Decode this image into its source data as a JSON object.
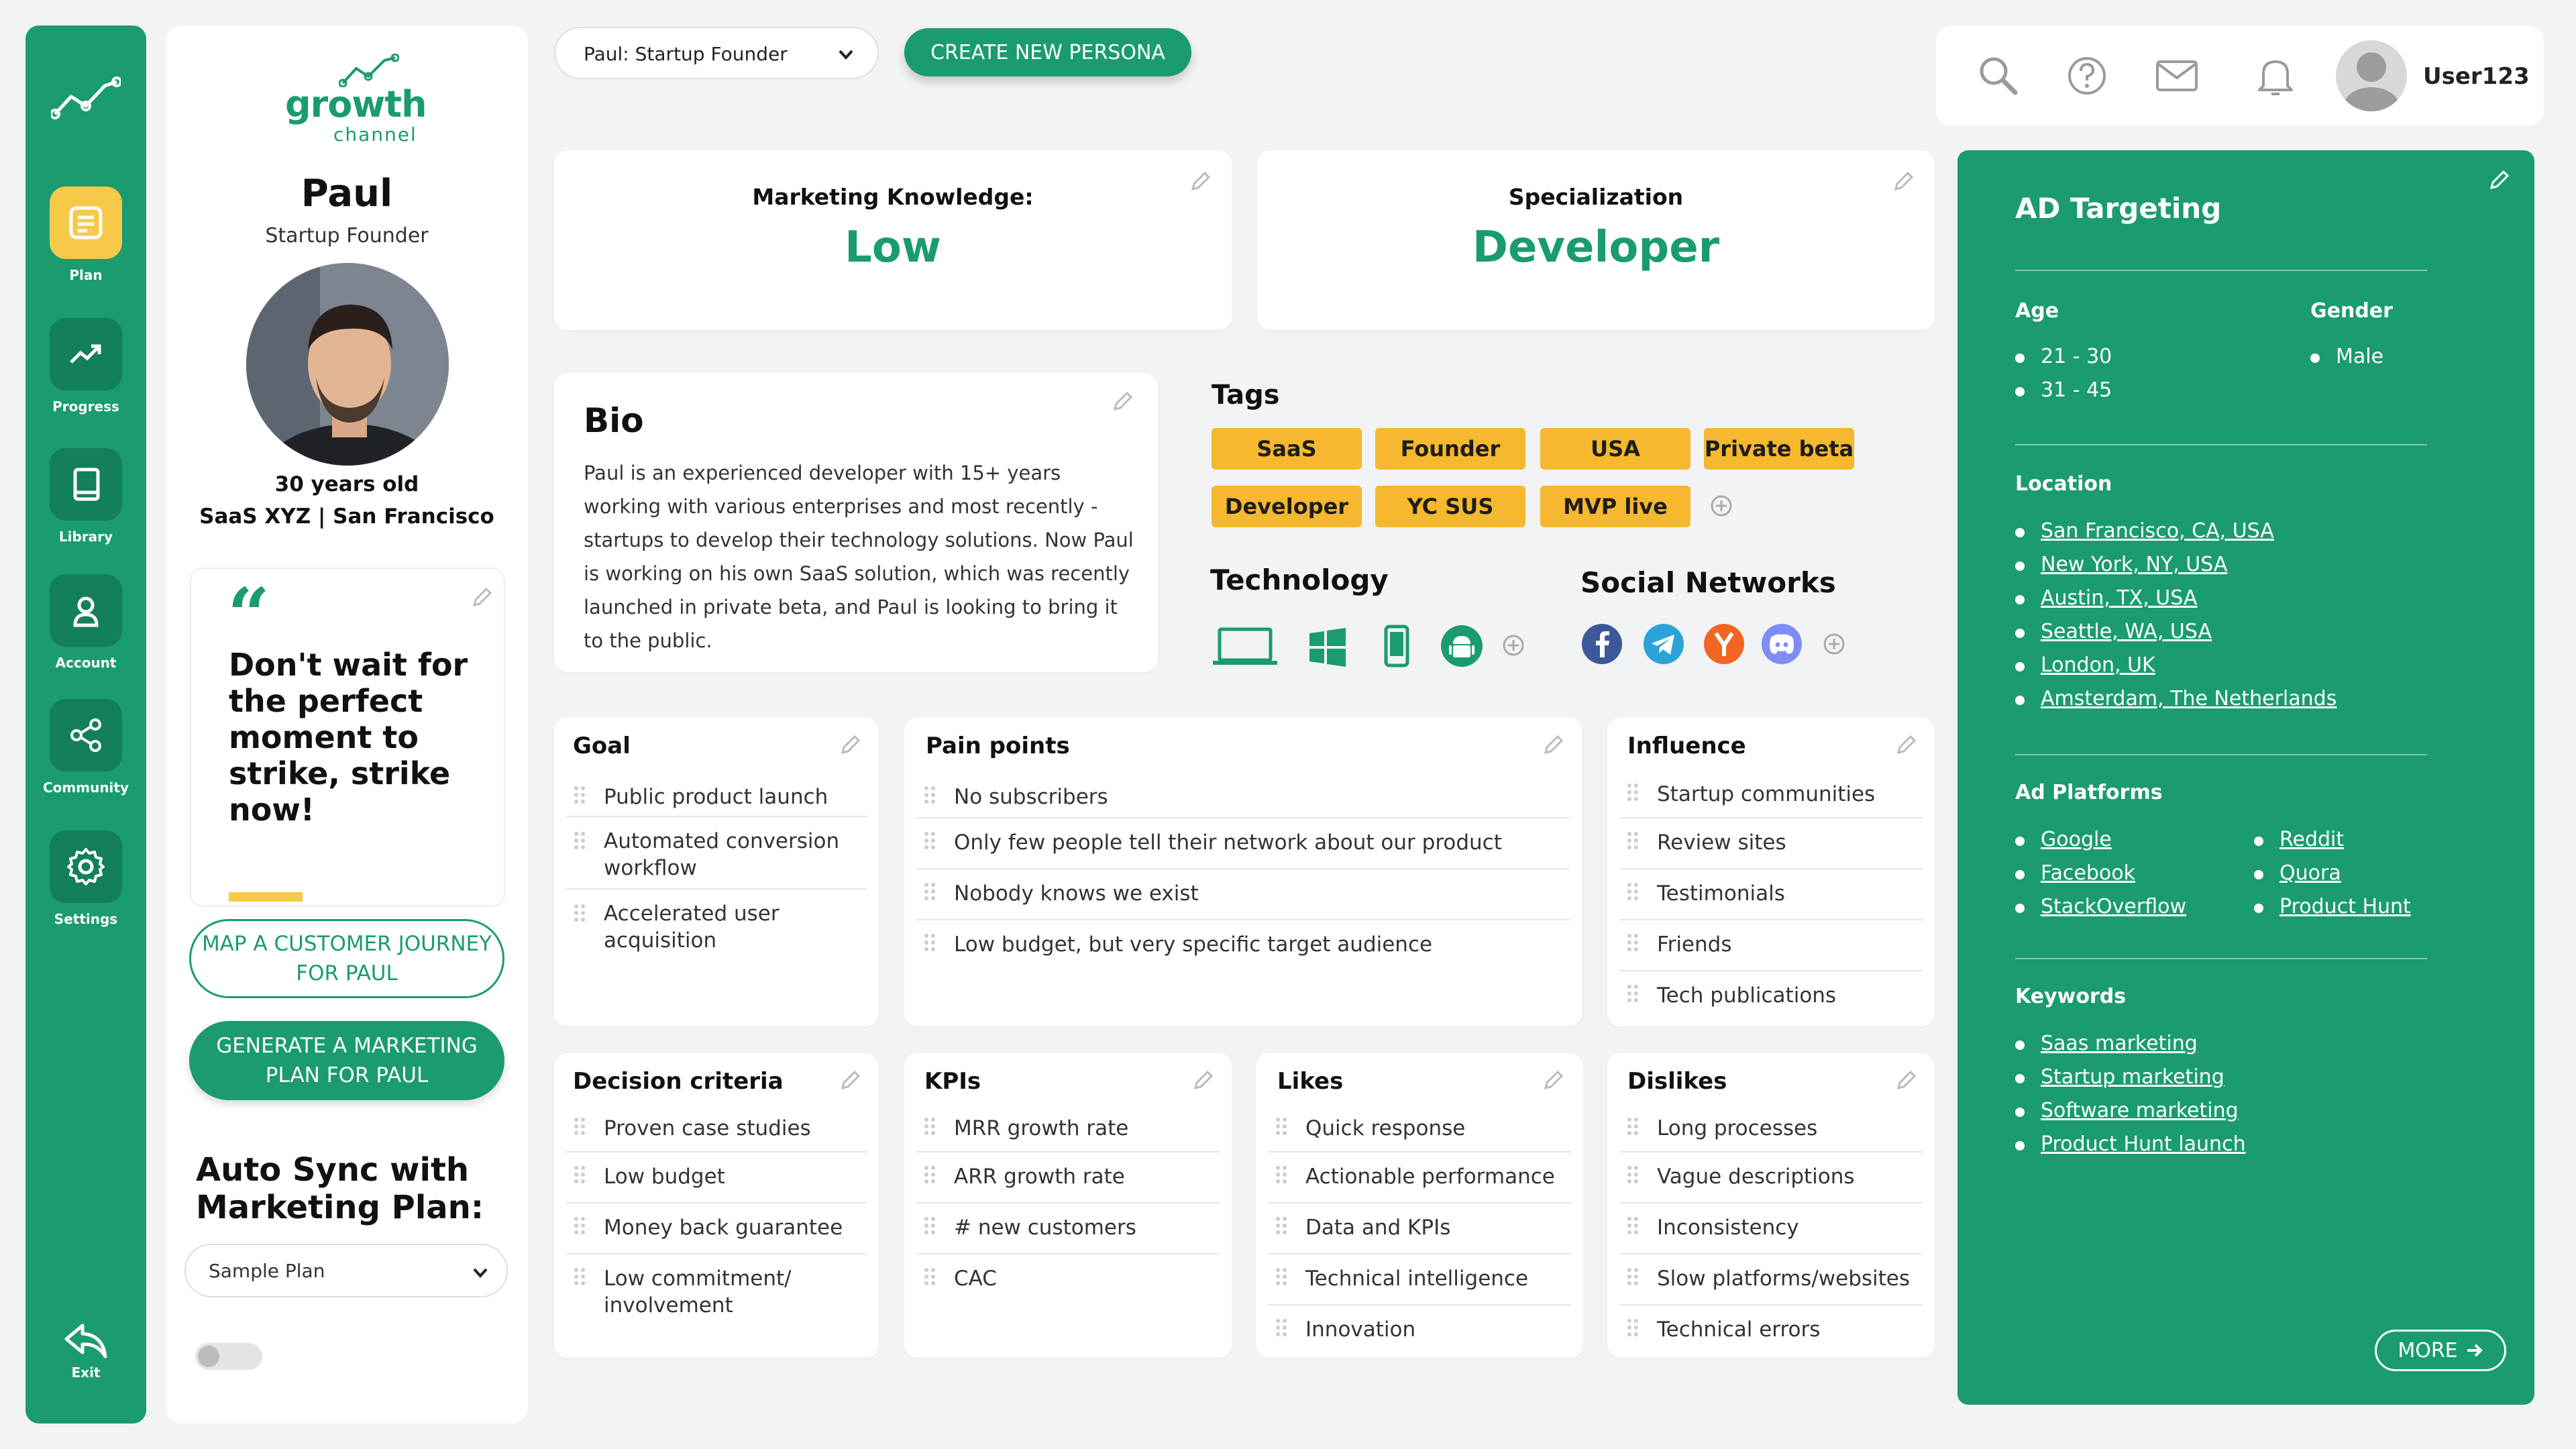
{
  "nav": {
    "items": [
      {
        "label": "Plan",
        "icon": "plan-icon"
      },
      {
        "label": "Progress",
        "icon": "trend-icon"
      },
      {
        "label": "Library",
        "icon": "book-icon"
      },
      {
        "label": "Account",
        "icon": "user-icon"
      },
      {
        "label": "Community",
        "icon": "share-icon"
      },
      {
        "label": "Settings",
        "icon": "gear-icon"
      }
    ],
    "exit_label": "Exit"
  },
  "brand": {
    "name": "growth",
    "sub": "channel"
  },
  "profile": {
    "name": "Paul",
    "role": "Startup Founder",
    "age": "30 years old",
    "company": "SaaS XYZ | San Francisco",
    "quote": "Don't wait for the perfect moment to strike, strike now!",
    "map_button": "MAP A CUSTOMER JOURNEY FOR PAUL",
    "generate_button": "GENERATE A MARKETING PLAN FOR PAUL",
    "sync_title": "Auto Sync with Marketing Plan:",
    "plan_select": "Sample Plan"
  },
  "header": {
    "persona_select": "Paul: Startup Founder",
    "create_button": "CREATE NEW PERSONA",
    "username": "User123"
  },
  "knowledge": {
    "label": "Marketing Knowledge:",
    "value": "Low"
  },
  "specialization": {
    "label": "Specialization",
    "value": "Developer"
  },
  "bio": {
    "title": "Bio",
    "text": "Paul is an experienced developer with 15+ years working with various enterprises and most recently - startups to develop their technology solutions. Now Paul is working on his own SaaS solution, which was recently launched in private beta, and Paul is looking to bring it to the public."
  },
  "tags": {
    "title": "Tags",
    "items": [
      "SaaS",
      "Founder",
      "USA",
      "Private beta",
      "Developer",
      "YC SUS",
      "MVP live"
    ]
  },
  "technology": {
    "title": "Technology",
    "icons": [
      "laptop-icon",
      "windows-icon",
      "mobile-icon",
      "android-icon"
    ]
  },
  "social": {
    "title": "Social Networks",
    "icons": [
      "facebook-icon",
      "telegram-icon",
      "ycombinator-icon",
      "discord-icon"
    ]
  },
  "goal": {
    "title": "Goal",
    "items": [
      "Public product launch",
      "Automated conversion workflow",
      "Accelerated user acquisition"
    ]
  },
  "pain": {
    "title": "Pain points",
    "items": [
      "No subscribers",
      "Only few people tell their network about our product",
      "Nobody knows we exist",
      "Low budget, but very specific target audience"
    ]
  },
  "influence": {
    "title": "Influence",
    "items": [
      "Startup communities",
      "Review sites",
      "Testimonials",
      "Friends",
      "Tech publications"
    ]
  },
  "decision": {
    "title": "Decision criteria",
    "items": [
      "Proven case studies",
      "Low budget",
      "Money back guarantee",
      "Low commitment/ involvement"
    ]
  },
  "kpis": {
    "title": "KPIs",
    "items": [
      "MRR growth rate",
      "ARR growth rate",
      "# new customers",
      "CAC"
    ]
  },
  "likes": {
    "title": "Likes",
    "items": [
      "Quick response",
      "Actionable performance",
      "Data and KPIs",
      "Technical intelligence",
      "Innovation"
    ]
  },
  "dislikes": {
    "title": "Dislikes",
    "items": [
      "Long processes",
      "Vague descriptions",
      "Inconsistency",
      "Slow platforms/websites",
      "Technical errors"
    ]
  },
  "ad": {
    "title": "AD Targeting",
    "age_title": "Age",
    "ages": [
      "21 - 30",
      "31 - 45"
    ],
    "gender_title": "Gender",
    "genders": [
      "Male"
    ],
    "location_title": "Location",
    "locations": [
      "San Francisco, CA, USA",
      "New York, NY, USA",
      "Austin, TX, USA",
      "Seattle, WA, USA",
      "London, UK",
      "Amsterdam, The Netherlands"
    ],
    "platforms_title": "Ad Platforms",
    "platforms_left": [
      "Google",
      "Facebook",
      "StackOverflow"
    ],
    "platforms_right": [
      "Reddit",
      "Quora",
      "Product Hunt"
    ],
    "keywords_title": "Keywords",
    "keywords": [
      "Saas marketing",
      "Startup marketing",
      "Software marketing",
      "Product Hunt launch"
    ],
    "more_button": "MORE"
  },
  "colors": {
    "accent": "#1a9b70",
    "tag": "#f5b82e",
    "plan_active": "#f7c948"
  }
}
